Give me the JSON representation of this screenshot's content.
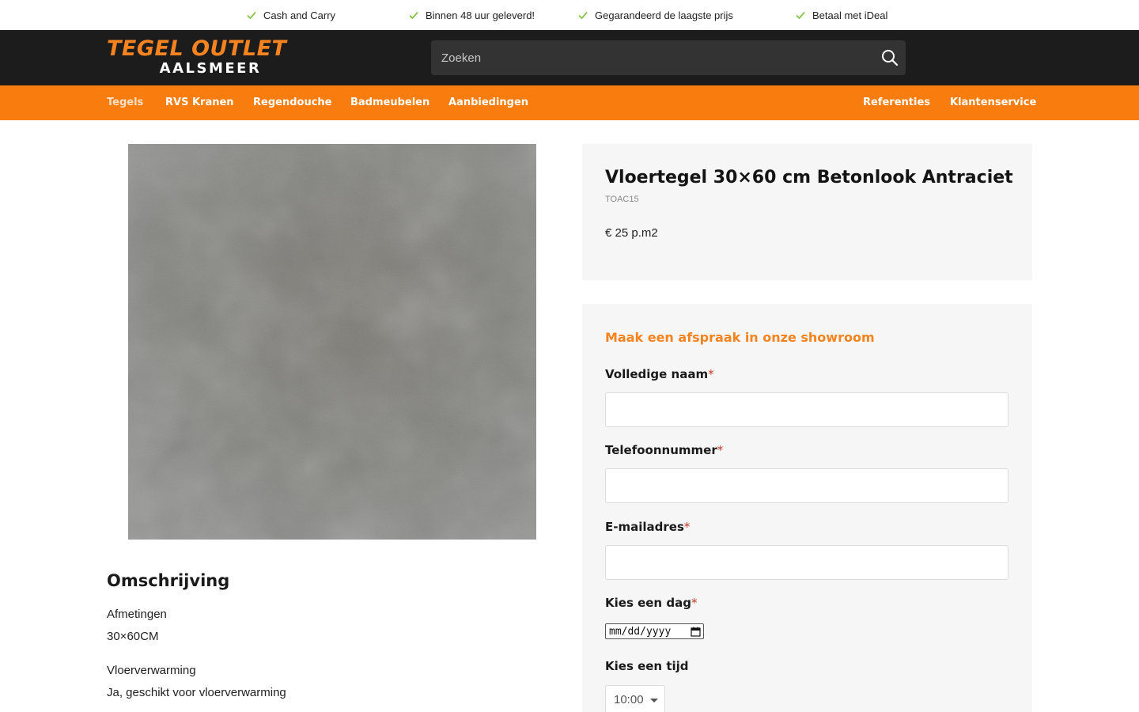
{
  "usp_bar": {
    "items": [
      {
        "label": "Cash and Carry",
        "icon": "check-icon"
      },
      {
        "label": "Binnen 48 uur geleverd!",
        "icon": "check-icon"
      },
      {
        "label": "Gegarandeerd de laagste prijs",
        "icon": "check-icon"
      },
      {
        "label": "Betaal met iDeal",
        "icon": "check-icon"
      }
    ],
    "check_color": "#8bc34a"
  },
  "header": {
    "logo_top": "TEGEL OUTLET",
    "logo_bottom": "AALSMEER",
    "search": {
      "placeholder": "Zoeken",
      "value": "",
      "icon": "search-icon"
    }
  },
  "nav": {
    "left": [
      {
        "label": "Tegels",
        "active": true
      },
      {
        "label": "RVS Kranen"
      },
      {
        "label": "Regendouche"
      },
      {
        "label": "Badmeubelen"
      },
      {
        "label": "Aanbiedingen"
      }
    ],
    "right": [
      {
        "label": "Referenties"
      },
      {
        "label": "Klantenservice"
      }
    ]
  },
  "product": {
    "title": "Vloertegel 30×60 cm Betonlook Antraciet",
    "sku": "TOAC15",
    "price": "€ 25 p.m2"
  },
  "description": {
    "title": "Omschrijving",
    "lines": [
      "Afmetingen",
      "30×60CM",
      "Vloerverwarming",
      "Ja, geschikt voor vloerverwarming"
    ]
  },
  "appointment_form": {
    "title": "Maak een afspraak in onze showroom",
    "required_marker": "*",
    "name_label": "Volledige naam",
    "phone_label": "Telefoonnummer",
    "email_label": "E-mailadres",
    "day_label": "Kies een dag",
    "day_value": "mm/dd/yyyy",
    "time_label": "Kies een tijd",
    "time_value": "10:00"
  },
  "colors": {
    "brand_orange": "#f87c0e",
    "header_dark": "#1c1c1c",
    "required_red": "#c0392b"
  }
}
